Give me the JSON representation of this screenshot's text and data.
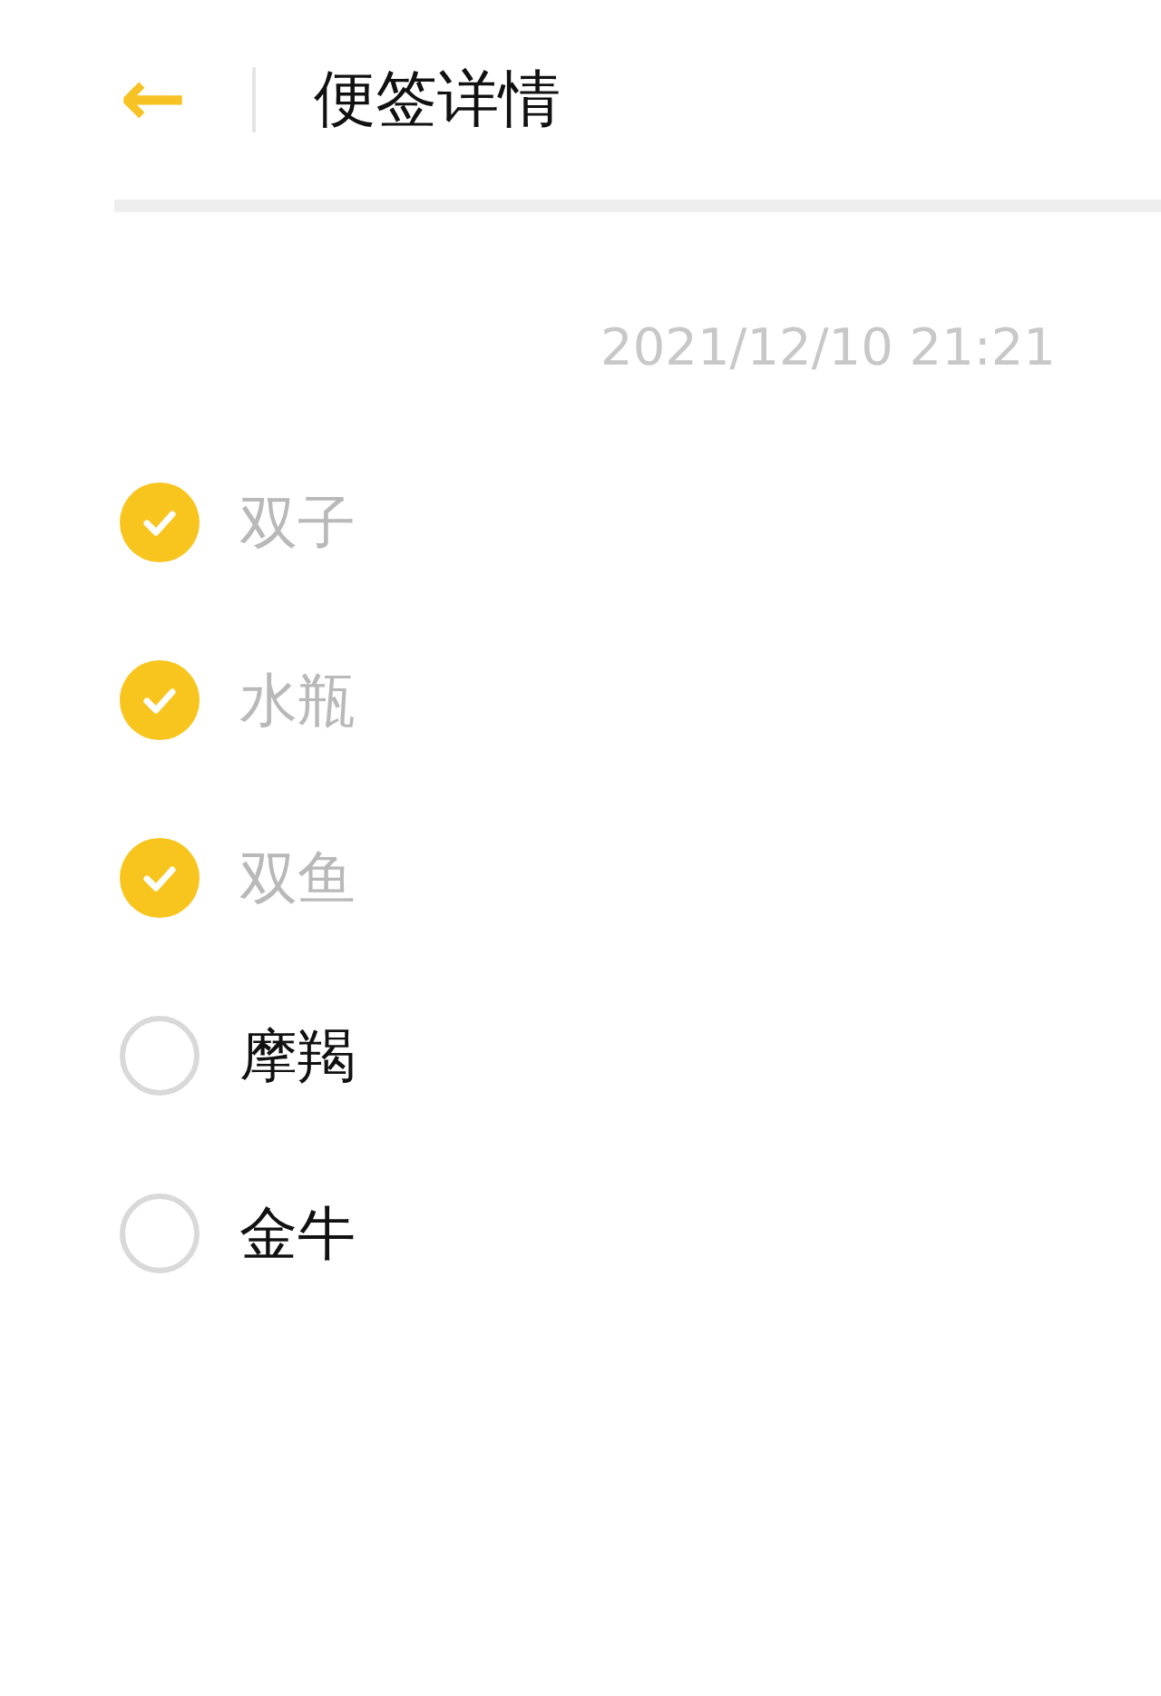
{
  "header": {
    "back_icon": "←",
    "title": "便签详情"
  },
  "timestamp": "2021/12/10 21:21",
  "items": [
    {
      "text": "双子",
      "checked": true
    },
    {
      "text": "水瓶",
      "checked": true
    },
    {
      "text": "双鱼",
      "checked": true
    },
    {
      "text": "摩羯",
      "checked": false
    },
    {
      "text": "金牛",
      "checked": false
    }
  ]
}
